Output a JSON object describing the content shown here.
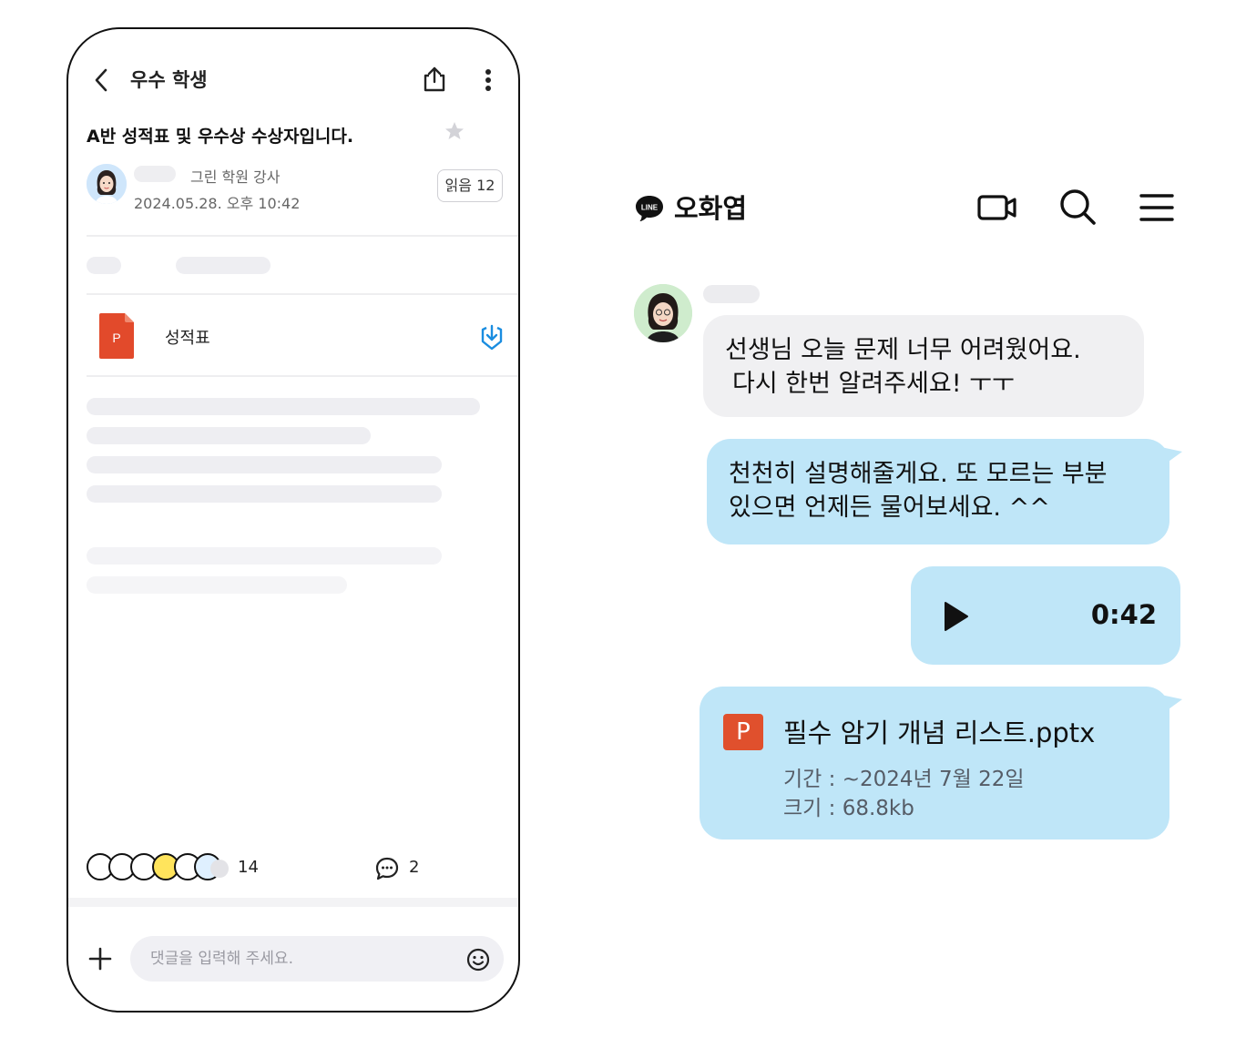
{
  "phone": {
    "header": {
      "title": "우수 학생",
      "icons": [
        "chevron-left-icon",
        "share-icon",
        "more-vertical-icon"
      ]
    },
    "post": {
      "title": "A반 성적표 및 우수상 수상자입니다.",
      "author_role": "그린 학원 강사",
      "date": "2024.05.28. 오후 10:42",
      "read_label": "읽음 12"
    },
    "attachment": {
      "icon_letter": "P",
      "name": "성적표"
    },
    "footer": {
      "reaction_count": "14",
      "comment_count": "2",
      "comment_placeholder": "댓글을 입력해 주세요."
    }
  },
  "chat": {
    "app": "LINE",
    "title": "오화엽",
    "header_icons": [
      "video-call-icon",
      "search-icon",
      "menu-icon"
    ],
    "messages": {
      "incoming_line1": "선생님 오늘 문제 너무 어려웠어요.",
      "incoming_line2": "다시 한번 알려주세요! ㅜㅜ",
      "outgoing_line1": "천천히 설명해줄게요. 또 모르는 부분",
      "outgoing_line2": "있으면 언제든 물어보세요. ^^",
      "voice_duration": "0:42",
      "file_icon_letter": "P",
      "file_name": "필수 암기 개념 리스트.pptx",
      "file_period": "기간 : ~2024년 7월 22일",
      "file_size": "크기 : 68.8kb"
    },
    "colors": {
      "outgoing_bubble": "#bfe6f8",
      "incoming_bubble": "#f0f0f2",
      "file_accent": "#e0502d"
    }
  }
}
